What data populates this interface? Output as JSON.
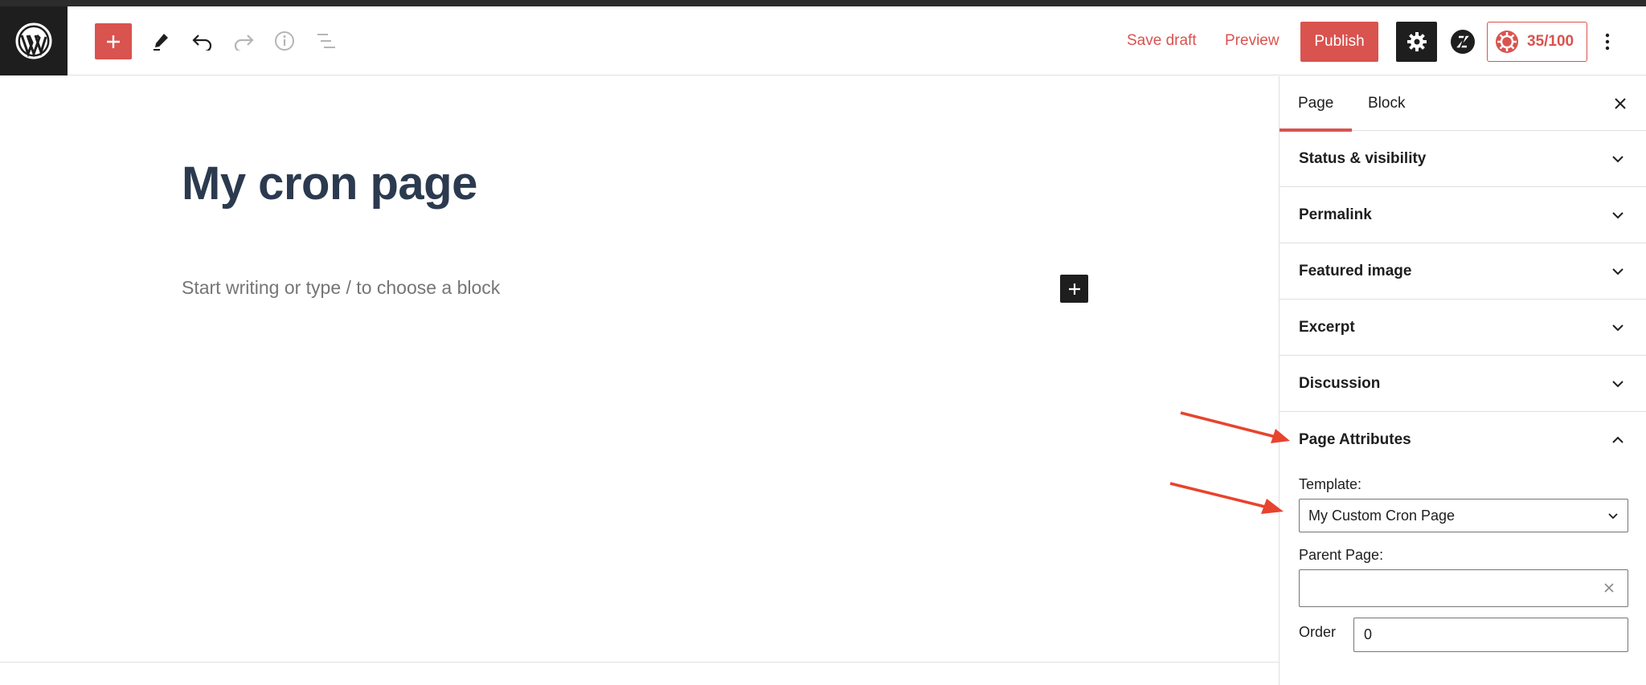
{
  "toolbar": {
    "logo_icon": "wordpress-logo-icon",
    "add_block_icon": "plus-icon",
    "tools_icon": "pencil-icon",
    "undo_icon": "undo-icon",
    "redo_icon": "redo-icon",
    "info_icon": "info-icon",
    "outline_icon": "list-view-icon",
    "save_draft_label": "Save draft",
    "preview_label": "Preview",
    "publish_label": "Publish",
    "settings_icon": "gear-icon",
    "plugin_icon": "plugin-logo-icon",
    "score_label": "35/100",
    "more_icon": "more-vertical-icon"
  },
  "editor": {
    "title": "My cron page",
    "placeholder": "Start writing or type / to choose a block"
  },
  "sidebar": {
    "tabs": [
      {
        "label": "Page",
        "active": true
      },
      {
        "label": "Block",
        "active": false
      }
    ],
    "panels": [
      {
        "title": "Status & visibility"
      },
      {
        "title": "Permalink"
      },
      {
        "title": "Featured image"
      },
      {
        "title": "Excerpt"
      },
      {
        "title": "Discussion"
      }
    ],
    "page_attributes": {
      "title": "Page Attributes",
      "template_label": "Template:",
      "template_value": "My Custom Cron Page",
      "parent_label": "Parent Page:",
      "parent_value": "",
      "order_label": "Order",
      "order_value": "0"
    }
  },
  "colors": {
    "accent": "#d9534f",
    "dark": "#1e1e1e",
    "arrow": "#e8432e"
  }
}
